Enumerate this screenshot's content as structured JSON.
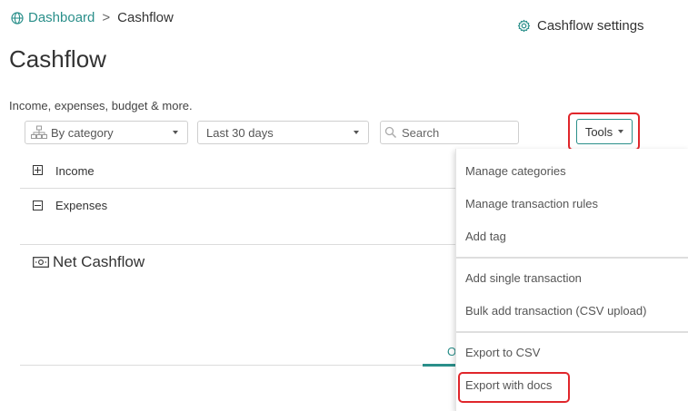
{
  "breadcrumb": {
    "home": "Dashboard",
    "separator": ">",
    "current": "Cashflow"
  },
  "header": {
    "settings_label": "Cashflow settings",
    "title": "Cashflow",
    "subtitle": "Income, expenses, budget & more."
  },
  "filters": {
    "group_by": "By category",
    "date_range": "Last 30 days",
    "search_placeholder": "Search",
    "tools_label": "Tools"
  },
  "rows": {
    "income": "Income",
    "expenses": "Expenses",
    "net": "Net Cashflow"
  },
  "tab_partial": "O",
  "tools_menu": {
    "items": [
      "Manage categories",
      "Manage transaction rules",
      "Add tag",
      "Add single transaction",
      "Bulk add transaction (CSV upload)",
      "Export to CSV",
      "Export with docs"
    ]
  },
  "colors": {
    "accent": "#2a8f8a",
    "highlight": "#e0262b"
  }
}
